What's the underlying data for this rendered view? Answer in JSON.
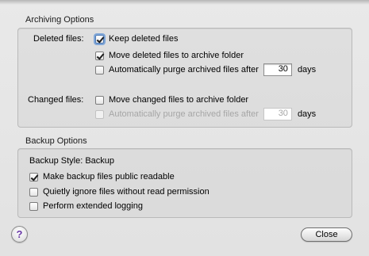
{
  "archiving": {
    "title": "Archiving Options",
    "deleted_label": "Deleted files:",
    "keep_deleted": {
      "label": "Keep deleted files",
      "checked": true
    },
    "move_deleted": {
      "label": "Move deleted files to archive folder",
      "checked": true
    },
    "purge_deleted": {
      "label": "Automatically purge archived files after",
      "checked": false,
      "days": "30",
      "days_label": "days"
    },
    "changed_label": "Changed files:",
    "move_changed": {
      "label": "Move changed files to archive folder",
      "checked": false
    },
    "purge_changed": {
      "label": "Automatically purge archived files after",
      "checked": false,
      "enabled": false,
      "days": "30",
      "days_label": "days"
    }
  },
  "backup": {
    "title": "Backup Options",
    "style_label": "Backup Style: Backup",
    "public_readable": {
      "label": "Make backup files public readable",
      "checked": true
    },
    "ignore_no_read": {
      "label": "Quietly ignore files without read permission",
      "checked": false
    },
    "extended_logging": {
      "label": "Perform extended logging",
      "checked": false
    }
  },
  "footer": {
    "help_glyph": "?",
    "close_label": "Close"
  },
  "colors": {
    "sheet_background": "#e6e6e6",
    "help_glyph": "#6a3aa8",
    "focus_ring": "#7fa6d8"
  }
}
